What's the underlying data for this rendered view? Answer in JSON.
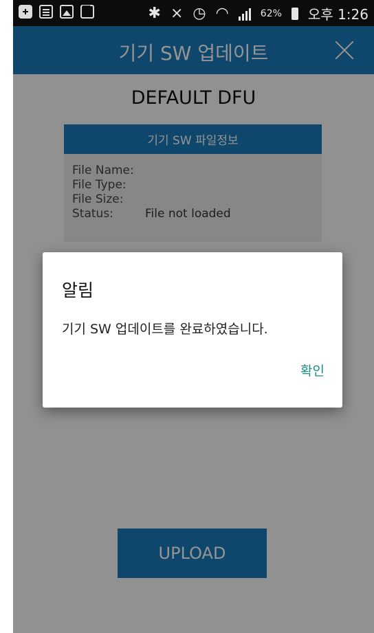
{
  "status_bar": {
    "battery_percent": "62%",
    "time": "오후 1:26",
    "left_icons": [
      "plus-icon",
      "note-icon",
      "image-icon",
      "mail-icon"
    ],
    "right_icons": [
      "bluetooth-icon",
      "mute-icon",
      "alarm-icon",
      "wifi-icon",
      "signal-icon",
      "battery-icon"
    ]
  },
  "app_bar": {
    "title": "기기 SW 업데이트",
    "background": "#1a79b8"
  },
  "main": {
    "title": "DEFAULT DFU",
    "info_card": {
      "header": "기기 SW 파일정보",
      "rows": [
        {
          "label": "File Name:",
          "value": ""
        },
        {
          "label": "File Type:",
          "value": ""
        },
        {
          "label": "File Size:",
          "value": ""
        },
        {
          "label": "Status:",
          "value": "File not loaded"
        }
      ]
    },
    "upload_label": "UPLOAD"
  },
  "dialog": {
    "title": "알림",
    "message": "기기 SW 업데이트를 완료하였습니다.",
    "ok_label": "확인",
    "ok_color": "#1a8f86"
  }
}
